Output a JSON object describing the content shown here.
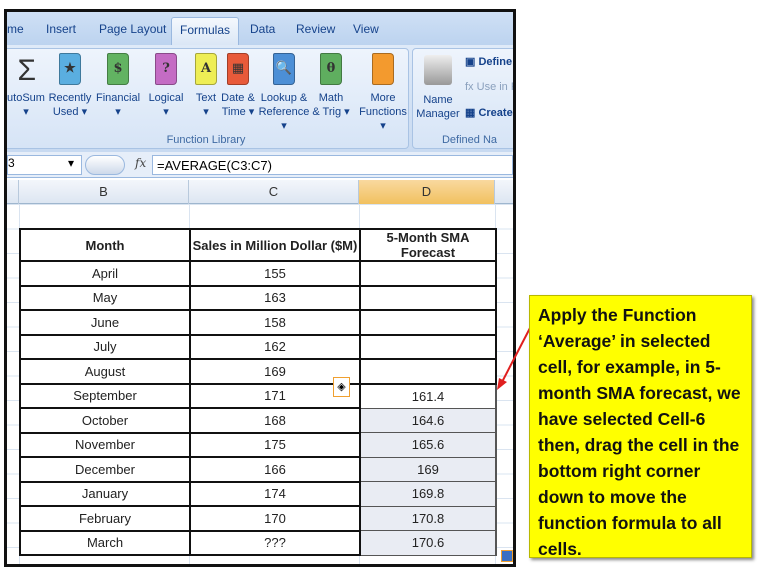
{
  "tabs": [
    "me",
    "Insert",
    "Page Layout",
    "Formulas",
    "Data",
    "Review",
    "View"
  ],
  "ribbon": {
    "function_library": {
      "label": "Function Library",
      "buttons": [
        {
          "l1": "utoSum",
          "l2": "▾",
          "icon": "sigma-icon"
        },
        {
          "l1": "Recently",
          "l2": "Used ▾",
          "icon": "star-book-icon",
          "color": "#5aaee0",
          "glyph": "★"
        },
        {
          "l1": "Financial",
          "l2": "▾",
          "icon": "financial-book-icon",
          "color": "#62b362",
          "glyph": "$"
        },
        {
          "l1": "Logical",
          "l2": "▾",
          "icon": "logical-book-icon",
          "color": "#c46cc4",
          "glyph": "?"
        },
        {
          "l1": "Text",
          "l2": "▾",
          "icon": "text-book-icon",
          "color": "#eeee55",
          "glyph": "A"
        },
        {
          "l1": "Date &",
          "l2": "Time ▾",
          "icon": "date-book-icon",
          "color": "#e85a3a",
          "glyph": "▦"
        },
        {
          "l1": "Lookup &",
          "l2": "Reference ▾",
          "icon": "lookup-book-icon",
          "color": "#4c8fd6",
          "glyph": "🔍"
        },
        {
          "l1": "Math",
          "l2": "& Trig ▾",
          "icon": "math-book-icon",
          "color": "#5fae5f",
          "glyph": "θ"
        },
        {
          "l1": "More",
          "l2": "Functions ▾",
          "icon": "more-books-icon",
          "color": "#f39a2e",
          "glyph": ""
        }
      ]
    },
    "defined_names": {
      "label": "Defined Na",
      "name_manager": [
        "Name",
        "Manager"
      ],
      "define": "Define",
      "use_in": "Use in F",
      "create": "Create f"
    }
  },
  "formula_bar": {
    "name_box": "3",
    "fx": "fx",
    "formula": "=AVERAGE(C3:C7)"
  },
  "columns": [
    "B",
    "C",
    "D"
  ],
  "table": {
    "headers": [
      "Month",
      "Sales in Million Dollar ($M)",
      "5-Month SMA Forecast"
    ],
    "rows": [
      [
        "April",
        "155",
        ""
      ],
      [
        "May",
        "163",
        ""
      ],
      [
        "June",
        "158",
        ""
      ],
      [
        "July",
        "162",
        ""
      ],
      [
        "August",
        "169",
        ""
      ],
      [
        "September",
        "171",
        "161.4"
      ],
      [
        "October",
        "168",
        "164.6"
      ],
      [
        "November",
        "175",
        "165.6"
      ],
      [
        "December",
        "166",
        "169"
      ],
      [
        "January",
        "174",
        "169.8"
      ],
      [
        "February",
        "170",
        "170.8"
      ],
      [
        "March",
        "???",
        "170.6"
      ]
    ]
  },
  "callout": "Apply the Function ‘Average’ in selected cell, for example, in 5-month SMA forecast, we have selected Cell-6 then, drag the cell in the bottom right corner down to move the function formula to all cells.",
  "colors": {
    "callout_bg": "#ffff00",
    "arrow": "#e02020",
    "selected_column": "#f1c15f"
  }
}
